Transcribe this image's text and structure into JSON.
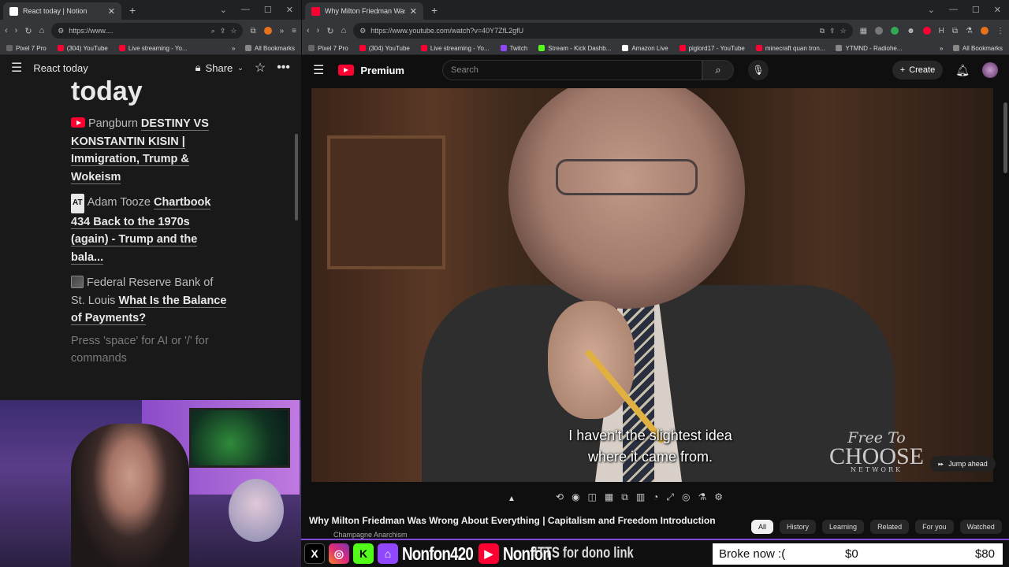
{
  "left_browser": {
    "tab_title": "React today | Notion",
    "url": "https://www....",
    "bookmarks": [
      "Pixel 7 Pro",
      "(304) YouTube",
      "Live streaming - Yo..."
    ],
    "all_bookmarks": "All Bookmarks"
  },
  "notion": {
    "page_name": "React today",
    "share_label": "Share",
    "title": "today",
    "entries": [
      {
        "icon": "youtube-icon",
        "source": "Pangburn",
        "link": "DESTINY VS KONSTANTIN KISIN | Immigration, Trump & Wokeism"
      },
      {
        "icon": "at-icon",
        "source": "Adam Tooze",
        "link": "Chartbook 434 Back to the 1970s (again) - Trump and the bala..."
      },
      {
        "icon": "image-icon",
        "source": "Federal Reserve Bank of St. Louis",
        "link": "What Is the Balance of Payments?"
      }
    ],
    "placeholder": "Press 'space' for AI or '/' for commands"
  },
  "right_browser": {
    "tab_title": "Why Milton Friedman Was Wro",
    "url": "https://www.youtube.com/watch?v=40Y7ZfL2gfU",
    "bookmarks": [
      "Pixel 7 Pro",
      "(304) YouTube",
      "Live streaming - Yo...",
      "Twitch",
      "Stream - Kick Dashb...",
      "Amazon Live",
      "piglord17 - YouTube",
      "minecraft quan tron...",
      "YTMND - Radiohe..."
    ],
    "all_bookmarks": "All Bookmarks"
  },
  "youtube": {
    "logo_text": "Premium",
    "search_placeholder": "Search",
    "create_label": "Create",
    "caption_line1": "I haven't the slightest idea",
    "caption_line2": "where it came from.",
    "watermark_l1": "Free To",
    "watermark_l2": "CHOOSE",
    "watermark_l3": "NETWORK",
    "jump_ahead": "Jump ahead",
    "video_title": "Why Milton Friedman Was Wrong About Everything | Capitalism and Freedom Introduction",
    "channel": "Champagne Anarchism",
    "chips": [
      "All",
      "History",
      "Learning",
      "Related",
      "For you",
      "Watched"
    ]
  },
  "overlay": {
    "handle1": "Nonfon420",
    "handle2": "Nonfon",
    "tts": "!TTS for dono link",
    "goal_label": "Broke now :(",
    "goal_current": "$0",
    "goal_target": "$80"
  },
  "colors": {
    "youtube_red": "#ff0033",
    "twitch_purple": "#9146ff",
    "kick_green": "#53fc18",
    "overlay_border": "#7d4bd6"
  }
}
